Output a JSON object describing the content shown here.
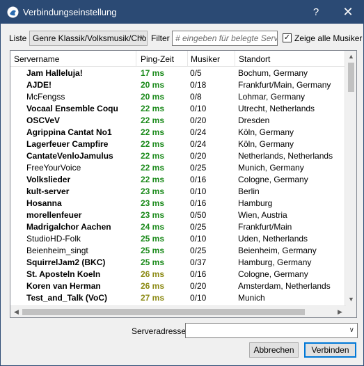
{
  "window": {
    "title": "Verbindungseinstellung",
    "help_label": "?",
    "close_label": "✕"
  },
  "filter": {
    "list_label": "Liste",
    "list_selected": "Genre Klassik/Volksmusik/Chor",
    "filter_label": "Filter",
    "filter_placeholder": "# eingeben für belegte Server",
    "show_all_label": "Zeige alle Musiker",
    "show_all_checked": true
  },
  "columns": [
    "Servername",
    "Ping-Zeit",
    "Musiker",
    "Standort"
  ],
  "servers": [
    {
      "name": "Jam Halleluja!",
      "ping": "17 ms",
      "musicians": "0/5",
      "location": "Bochum, Germany",
      "bold": true,
      "ping_color": "green"
    },
    {
      "name": "AJDE!",
      "ping": "20 ms",
      "musicians": "0/18",
      "location": "Frankfurt/Main, Germany",
      "bold": true,
      "ping_color": "green"
    },
    {
      "name": "McFengss",
      "ping": "20 ms",
      "musicians": "0/8",
      "location": "Lohmar, Germany",
      "bold": false,
      "ping_color": "green"
    },
    {
      "name": "Vocaal Ensemble Coqu",
      "ping": "22 ms",
      "musicians": "0/10",
      "location": "Utrecht, Netherlands",
      "bold": true,
      "ping_color": "green"
    },
    {
      "name": "OSCVeV",
      "ping": "22 ms",
      "musicians": "0/20",
      "location": "Dresden",
      "bold": true,
      "ping_color": "green"
    },
    {
      "name": "Agrippina Cantat No1",
      "ping": "22 ms",
      "musicians": "0/24",
      "location": "Köln, Germany",
      "bold": true,
      "ping_color": "green"
    },
    {
      "name": "Lagerfeuer Campfire",
      "ping": "22 ms",
      "musicians": "0/24",
      "location": "Köln, Germany",
      "bold": true,
      "ping_color": "green"
    },
    {
      "name": "CantateVenloJamulus",
      "ping": "22 ms",
      "musicians": "0/20",
      "location": "Netherlands, Netherlands",
      "bold": true,
      "ping_color": "green"
    },
    {
      "name": "FreeYourVoice",
      "ping": "22 ms",
      "musicians": "0/25",
      "location": "Munich, Germany",
      "bold": false,
      "ping_color": "green"
    },
    {
      "name": "Volkslieder",
      "ping": "22 ms",
      "musicians": "0/16",
      "location": "Cologne, Germany",
      "bold": true,
      "ping_color": "green"
    },
    {
      "name": "kult-server",
      "ping": "23 ms",
      "musicians": "0/10",
      "location": "Berlin",
      "bold": true,
      "ping_color": "green"
    },
    {
      "name": "Hosanna",
      "ping": "23 ms",
      "musicians": "0/16",
      "location": "Hamburg",
      "bold": true,
      "ping_color": "green"
    },
    {
      "name": "morellenfeuer",
      "ping": "23 ms",
      "musicians": "0/50",
      "location": "Wien, Austria",
      "bold": true,
      "ping_color": "green"
    },
    {
      "name": "Madrigalchor Aachen",
      "ping": "24 ms",
      "musicians": "0/25",
      "location": "Frankfurt/Main",
      "bold": true,
      "ping_color": "green"
    },
    {
      "name": "StudioHD-Folk",
      "ping": "25 ms",
      "musicians": "0/10",
      "location": "Uden, Netherlands",
      "bold": false,
      "ping_color": "green"
    },
    {
      "name": "Beienheim_singt",
      "ping": "25 ms",
      "musicians": "0/25",
      "location": "Beienheim, Germany",
      "bold": false,
      "ping_color": "green"
    },
    {
      "name": "SquirrelJam2 (BKC)",
      "ping": "25 ms",
      "musicians": "0/37",
      "location": "Hamburg, Germany",
      "bold": true,
      "ping_color": "green"
    },
    {
      "name": "St. Aposteln Koeln",
      "ping": "26 ms",
      "musicians": "0/16",
      "location": "Cologne, Germany",
      "bold": true,
      "ping_color": "olive"
    },
    {
      "name": "Koren van Herman",
      "ping": "26 ms",
      "musicians": "0/20",
      "location": "Amsterdam, Netherlands",
      "bold": true,
      "ping_color": "olive"
    },
    {
      "name": "Test_and_Talk (VoC)",
      "ping": "27 ms",
      "musicians": "0/10",
      "location": "Munich",
      "bold": true,
      "ping_color": "olive"
    }
  ],
  "server_address": {
    "label": "Serveradresse",
    "value": ""
  },
  "buttons": {
    "cancel": "Abbrechen",
    "connect": "Verbinden"
  }
}
